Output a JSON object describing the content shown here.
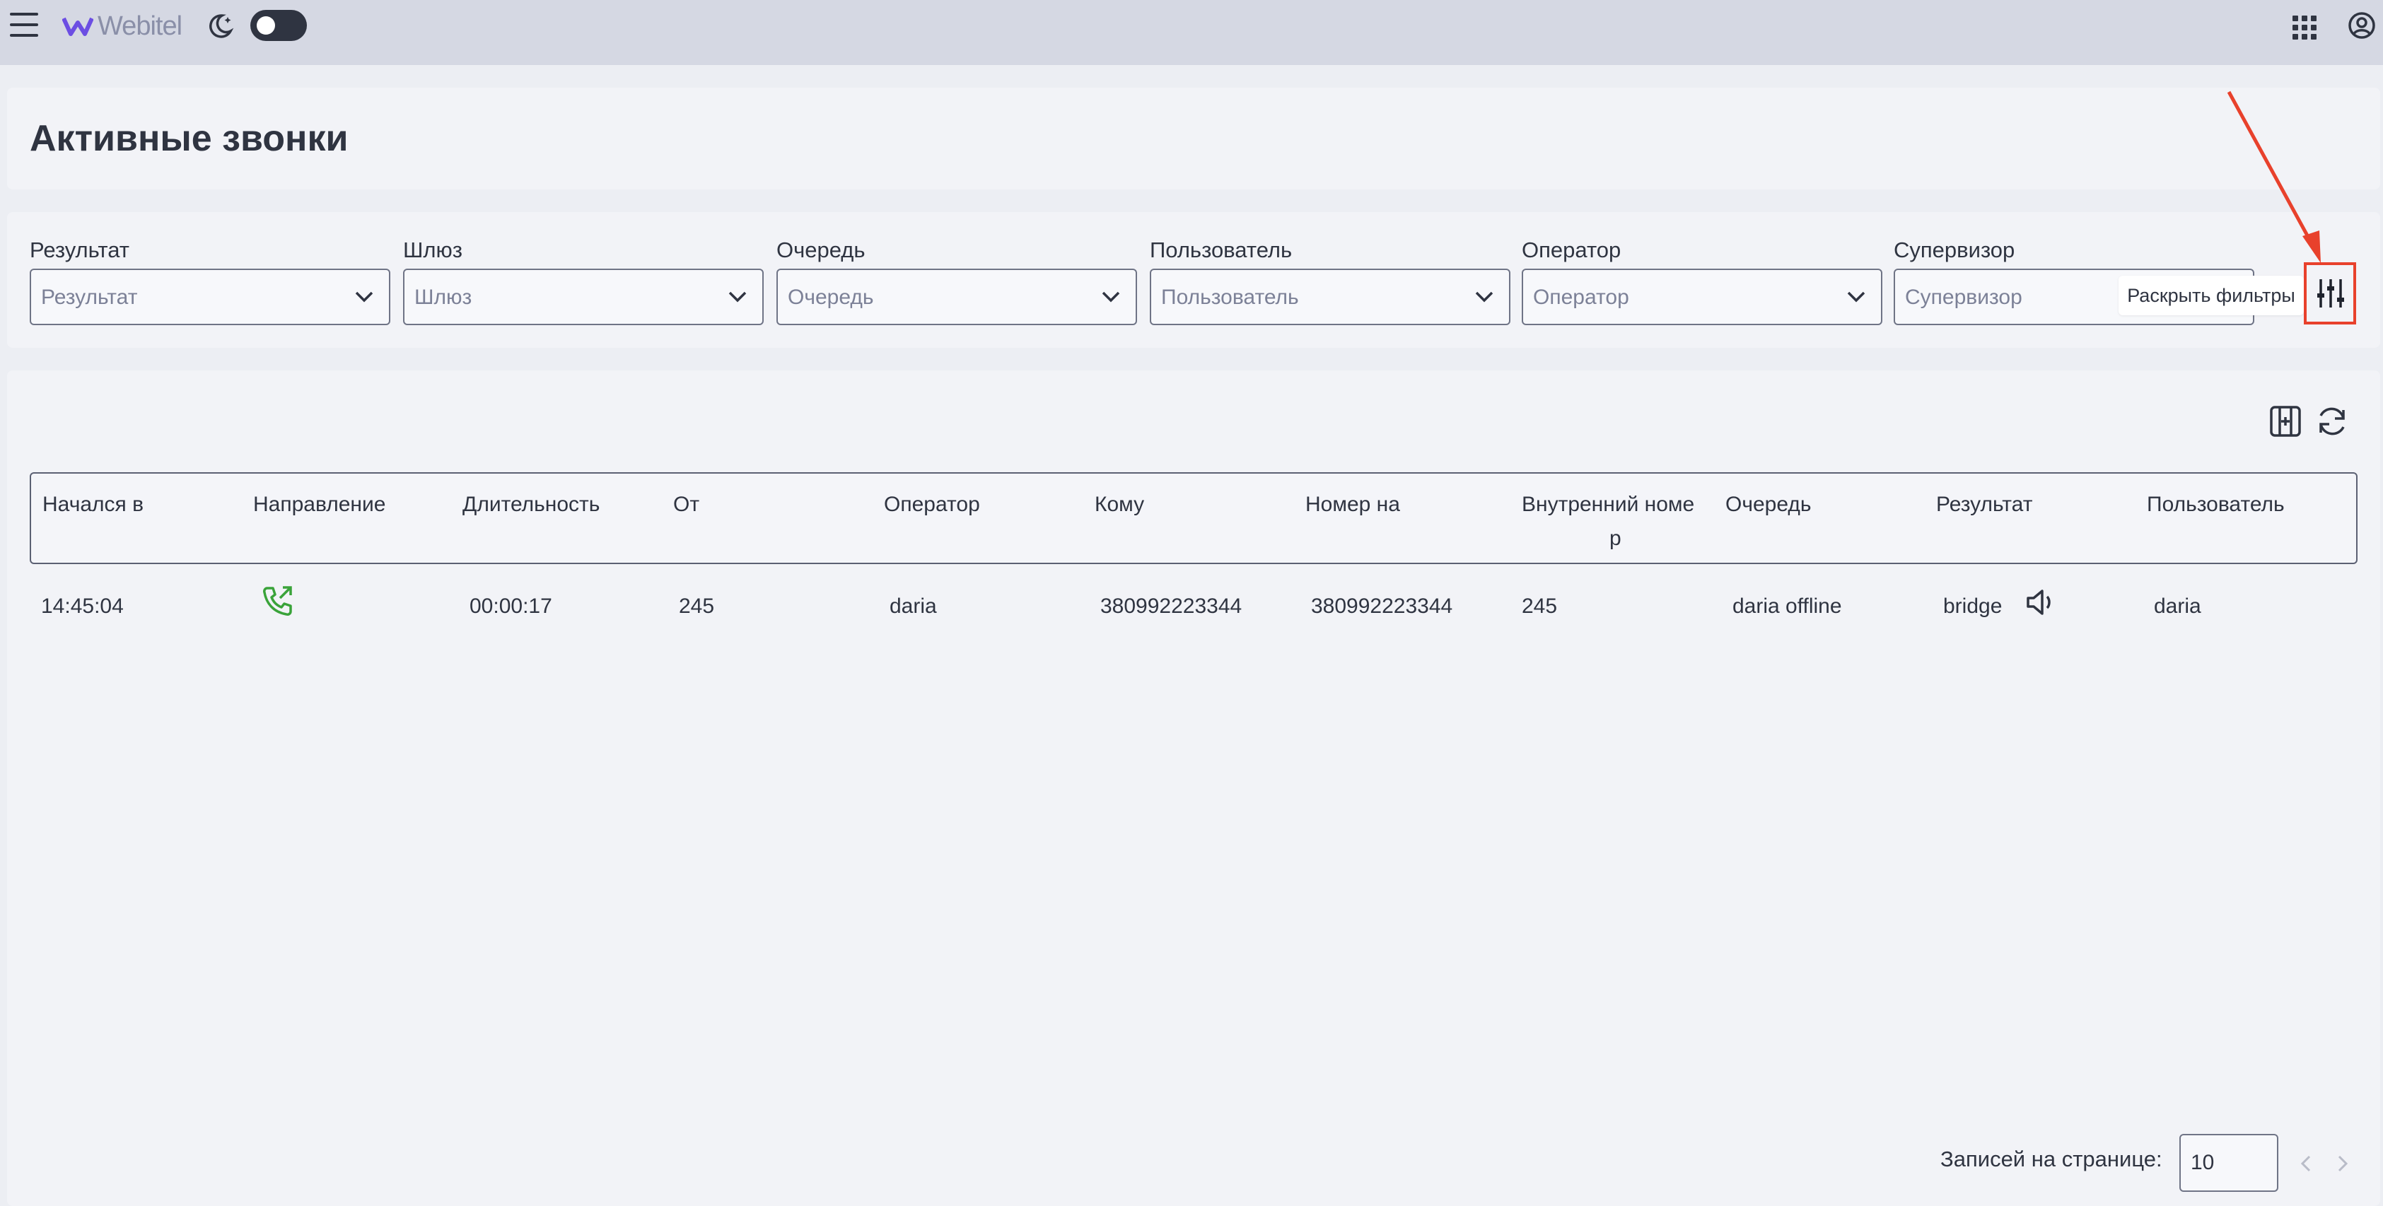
{
  "header": {
    "brand": "Webitel",
    "icons": [
      "menu-icon",
      "webitel-logo-icon",
      "moon-stars-icon",
      "apps-grid-icon",
      "account-circle-icon"
    ],
    "theme_toggle": "off"
  },
  "page": {
    "title": "Активные звонки"
  },
  "filters": [
    {
      "label": "Результат",
      "placeholder": "Результат"
    },
    {
      "label": "Шлюз",
      "placeholder": "Шлюз"
    },
    {
      "label": "Очередь",
      "placeholder": "Очередь"
    },
    {
      "label": "Пользователь",
      "placeholder": "Пользователь"
    },
    {
      "label": "Оператор",
      "placeholder": "Оператор"
    },
    {
      "label": "Супервизор",
      "placeholder": "Супервизор"
    }
  ],
  "filter_toggle": {
    "tooltip": "Раскрыть фильтры",
    "icon": "sliders-icon",
    "highlight_color": "#e8412c"
  },
  "table": {
    "actions": [
      "column-select-icon",
      "refresh-icon"
    ],
    "columns": [
      "Начался в",
      "Направление",
      "Длительность",
      "От",
      "Оператор",
      "Кому",
      "Номер на",
      "Внутренний номе",
      "р",
      "Очередь",
      "Результат",
      "Пользователь"
    ],
    "rows": [
      {
        "started": "14:45:04",
        "direction_icon": "outbound-call-icon",
        "duration": "00:00:17",
        "from": "245",
        "operator": "daria",
        "to": "380992223344",
        "number": "380992223344",
        "extension": "245",
        "queue": "daria offline",
        "result": "bridge",
        "result_icon": "speaker-icon",
        "user": "daria"
      }
    ]
  },
  "pagination": {
    "label": "Записей на странице:",
    "size": "10"
  },
  "colors": {
    "topbar": "#d5d8e3",
    "background": "#eceef3",
    "panel": "#f2f3f7",
    "text": "#2f3441",
    "accent_purple": "#6c4ee3",
    "call_green": "#3aa33a"
  }
}
